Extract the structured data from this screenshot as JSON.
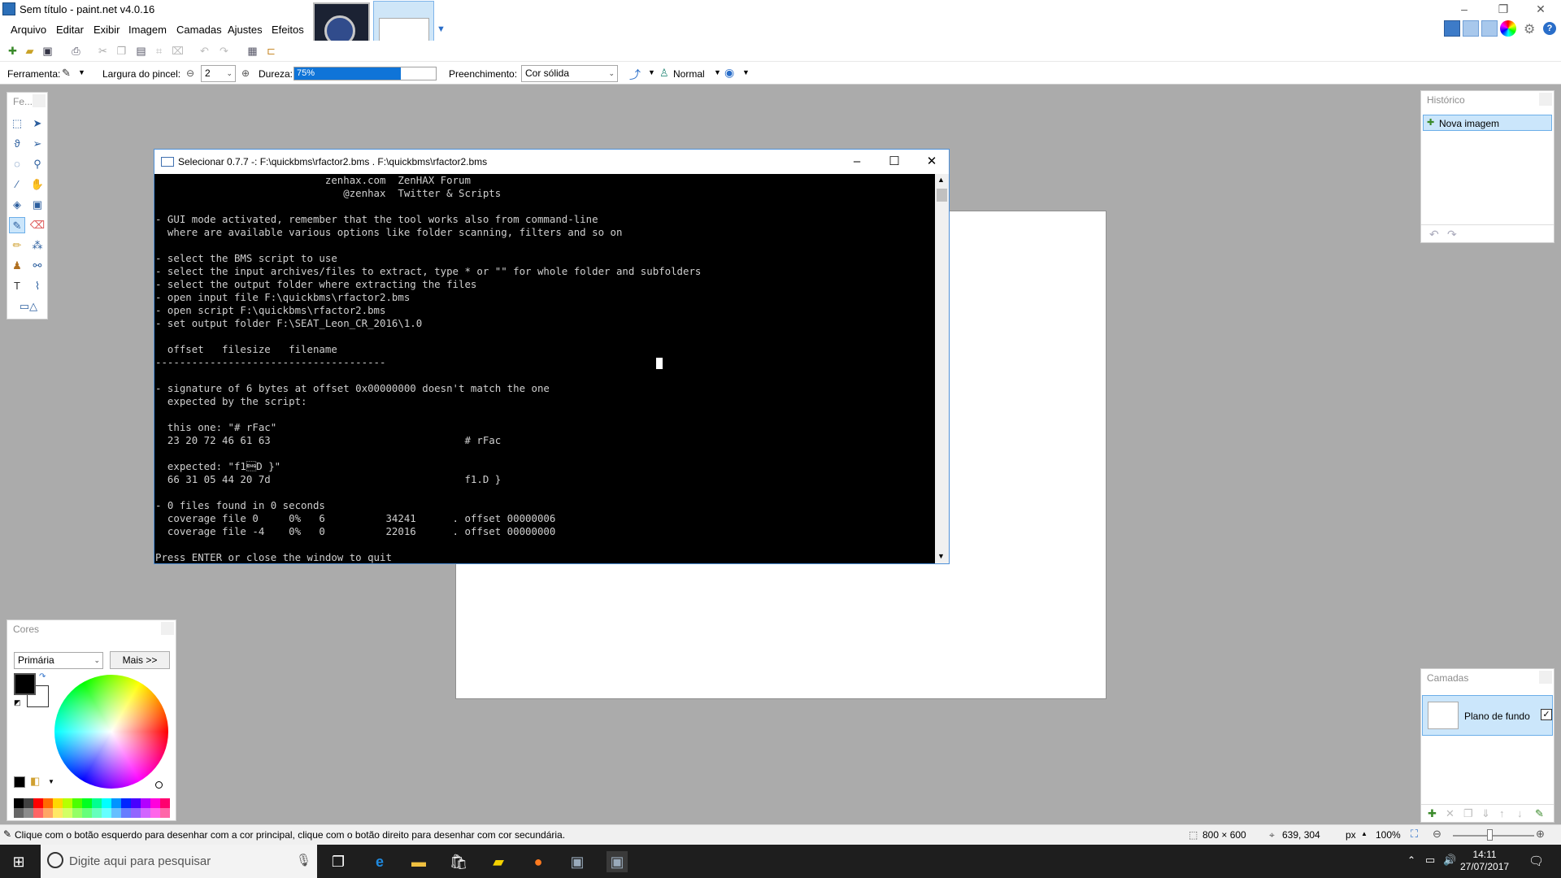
{
  "window": {
    "title": "Sem título - paint.net v4.0.16"
  },
  "menu": [
    "Arquivo",
    "Editar",
    "Exibir",
    "Imagem",
    "Camadas",
    "Ajustes",
    "Efeitos"
  ],
  "toolbar": {
    "tool_label": "Ferramenta:",
    "brush_width_label": "Largura do pincel:",
    "brush_width_value": "2",
    "hardness_label": "Dureza:",
    "hardness_value": "75%",
    "hardness_fraction": 0.75,
    "fill_label": "Preenchimento:",
    "fill_value": "Cor sólida",
    "blend_mode": "Normal"
  },
  "tools_panel": {
    "title": "Fe..."
  },
  "console": {
    "title": "Selecionar 0.7.7 -: F:\\quickbms\\rfactor2.bms . F:\\quickbms\\rfactor2.bms",
    "lines": [
      "                            zenhax.com  ZenHAX Forum",
      "                               @zenhax  Twitter & Scripts",
      "",
      "- GUI mode activated, remember that the tool works also from command-line",
      "  where are available various options like folder scanning, filters and so on",
      "",
      "- select the BMS script to use",
      "- select the input archives/files to extract, type * or \"\" for whole folder and subfolders",
      "- select the output folder where extracting the files",
      "- open input file F:\\quickbms\\rfactor2.bms",
      "- open script F:\\quickbms\\rfactor2.bms",
      "- set output folder F:\\SEAT_Leon_CR_2016\\1.0",
      "",
      "  offset   filesize   filename",
      "--------------------------------------",
      "",
      "- signature of 6 bytes at offset 0x00000000 doesn't match the one",
      "  expected by the script:",
      "",
      "  this one: \"# rFac\"",
      "  23 20 72 46 61 63                                # rFac",
      "",
      "  expected: \"f1\u0005D }\"",
      "  66 31 05 44 20 7d                                f1.D }",
      "",
      "- 0 files found in 0 seconds",
      "  coverage file 0     0%   6          34241      . offset 00000006",
      "  coverage file -4    0%   0          22016      . offset 00000000",
      "",
      "Press ENTER or close the window to quit"
    ]
  },
  "history": {
    "title": "Histórico",
    "items": [
      "Nova imagem"
    ]
  },
  "layers": {
    "title": "Camadas",
    "items": [
      "Plano de fundo"
    ]
  },
  "colors_panel": {
    "title": "Cores",
    "mode": "Primária",
    "more_button": "Mais >>",
    "primary": "#000000",
    "secondary": "#ffffff",
    "palette": [
      "#000000",
      "#404040",
      "#ff0000",
      "#ff6a00",
      "#ffd800",
      "#b6ff00",
      "#4cff00",
      "#00ff21",
      "#00ff90",
      "#00ffff",
      "#0094ff",
      "#0026ff",
      "#4800ff",
      "#b200ff",
      "#ff00dc",
      "#ff006e"
    ]
  },
  "status": {
    "hint": "Clique com o botão esquerdo para desenhar com a cor principal, clique com o botão direito para desenhar com cor secundária.",
    "image_size": "800 × 600",
    "cursor_pos": "639, 304",
    "unit": "px",
    "zoom": "100%"
  },
  "taskbar": {
    "search_placeholder": "Digite aqui para pesquisar",
    "time": "14:11",
    "date": "27/07/2017"
  }
}
